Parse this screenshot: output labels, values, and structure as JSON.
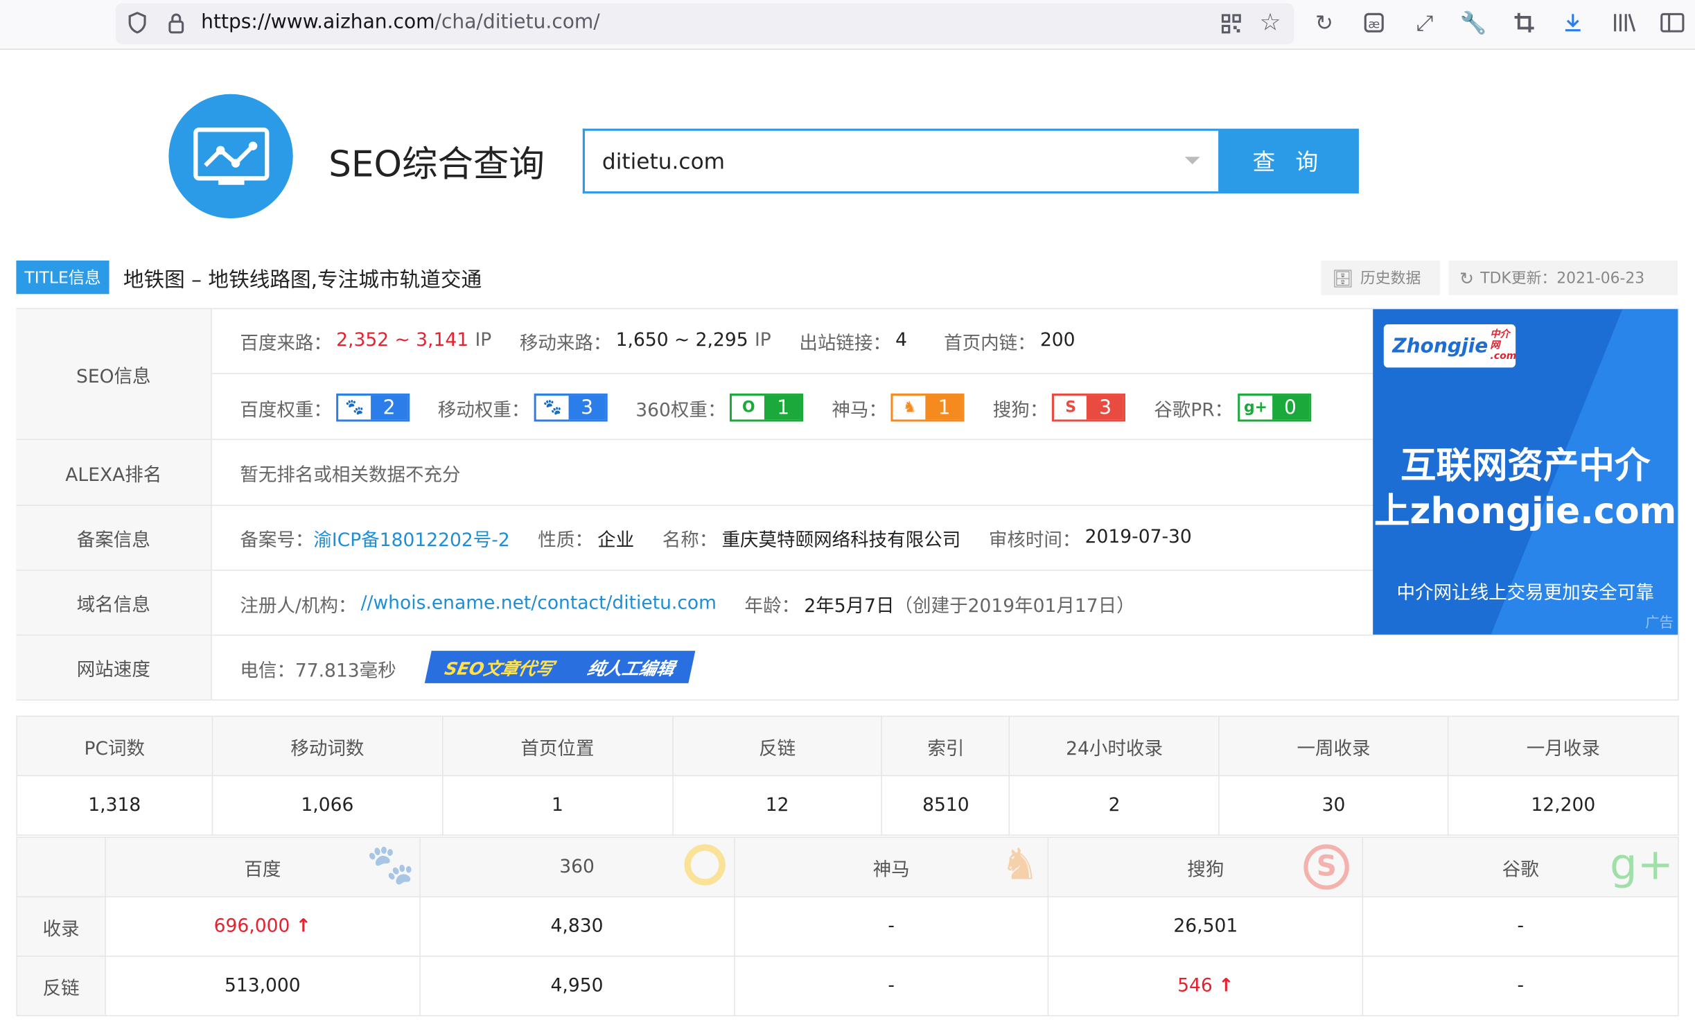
{
  "browser": {
    "url_host": "https://www.aizhan.com",
    "url_path": "/cha/ditietu.com/"
  },
  "header": {
    "site_name": "SEO综合查询",
    "search_value": "ditietu.com",
    "search_button": "查 询"
  },
  "title_row": {
    "badge": "TITLE信息",
    "title": "地铁图 – 地铁线路图,专注城市轨道交通",
    "history_button": "历史数据",
    "tdk_update": "TDK更新：2021-06-23"
  },
  "seo": {
    "label": "SEO信息",
    "baidu_traffic_label": "百度来路：",
    "baidu_traffic_value": "2,352 ~ 3,141",
    "ip1": "IP",
    "mobile_traffic_label": "移动来路：",
    "mobile_traffic_value": "1,650 ~ 2,295",
    "ip2": "IP",
    "outlinks_label": "出站链接：",
    "outlinks_value": "4",
    "homepage_links_label": "首页内链：",
    "homepage_links_value": "200",
    "ranks": [
      {
        "label": "百度权重：",
        "value": "2",
        "color": "#2b7de9",
        "icon": "paw-icon",
        "glyph": "🐾"
      },
      {
        "label": "移动权重：",
        "value": "3",
        "color": "#2b7de9",
        "icon": "paw-icon",
        "glyph": "🐾"
      },
      {
        "label": "360权重：",
        "value": "1",
        "color": "#1ca93b",
        "icon": "360-icon",
        "glyph": "O"
      },
      {
        "label": "神马：",
        "value": "1",
        "color": "#f58a1f",
        "icon": "shenma-icon",
        "glyph": "♞"
      },
      {
        "label": "搜狗：",
        "value": "3",
        "color": "#e94b40",
        "icon": "sogou-icon",
        "glyph": "S"
      },
      {
        "label": "谷歌PR：",
        "value": "0",
        "color": "#1ca93b",
        "icon": "google-plus-icon",
        "glyph": "g+"
      }
    ]
  },
  "alexa": {
    "label": "ALEXA排名",
    "value": "暂无排名或相关数据不充分"
  },
  "icp": {
    "label": "备案信息",
    "num_label": "备案号：",
    "num_value": "渝ICP备18012202号-2",
    "type_label": "性质：",
    "type_value": "企业",
    "name_label": "名称：",
    "name_value": "重庆莫特颐网络科技有限公司",
    "time_label": "审核时间：",
    "time_value": "2019-07-30"
  },
  "domain": {
    "label": "域名信息",
    "reg_label": "注册人/机构：",
    "reg_value": "//whois.ename.net/contact/ditietu.com",
    "age_label": "年龄：",
    "age_value": "2年5月7日",
    "created": "（创建于2019年01月17日）"
  },
  "speed": {
    "label": "网站速度",
    "value": "电信：77.813毫秒",
    "banner_a": "SEO文章代写",
    "banner_b": "纯人工编辑"
  },
  "ad": {
    "brand": "Zhongjie",
    "brand_sub": "中介网",
    "brand_com": ".com",
    "line1": "互联网资产中介",
    "line2": "上zhongjie.com",
    "line3": "中介网让线上交易更加安全可靠",
    "tag": "广告"
  },
  "stats": {
    "headers": [
      "PC词数",
      "移动词数",
      "首页位置",
      "反链",
      "索引",
      "24小时收录",
      "一周收录",
      "一月收录"
    ],
    "values": [
      "1,318",
      "1,066",
      "1",
      "12",
      "8510",
      "2",
      "30",
      "12,200"
    ]
  },
  "engines": {
    "headers": [
      "百度",
      "360",
      "神马",
      "搜狗",
      "谷歌"
    ],
    "rows": [
      {
        "label": "收录",
        "cells": [
          "696,000",
          "4,830",
          "-",
          "26,501",
          "-"
        ],
        "up": [
          true,
          false,
          false,
          false,
          false
        ]
      },
      {
        "label": "反链",
        "cells": [
          "513,000",
          "4,950",
          "-",
          "546",
          "-"
        ],
        "up": [
          false,
          false,
          false,
          true,
          false
        ]
      }
    ]
  }
}
